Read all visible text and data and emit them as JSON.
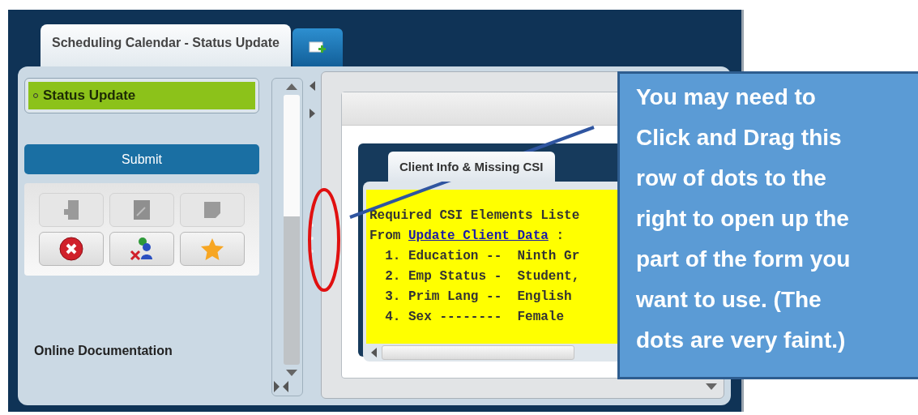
{
  "tabs": [
    {
      "label": "Scheduling Calendar - Status Update",
      "selected": true
    }
  ],
  "nav": [
    {
      "label": "Status Update",
      "selected": true
    }
  ],
  "submit_button": "Submit",
  "tool_buttons": [
    {
      "kind": "page",
      "disabled": true
    },
    {
      "kind": "edit",
      "disabled": true
    },
    {
      "kind": "note",
      "disabled": true
    },
    {
      "kind": "cancel",
      "disabled": false
    },
    {
      "kind": "remove-people",
      "disabled": false
    },
    {
      "kind": "star",
      "disabled": false
    }
  ],
  "documentation_link": "Online Documentation",
  "inner_panel": {
    "tabs": [
      {
        "label": "Client Info & Missing CSI",
        "selected": true
      }
    ],
    "lines": [
      {
        "text": "Required CSI Elements Liste"
      },
      {
        "text": "From ",
        "link": "Update Client Data",
        "rest": " :"
      },
      {
        "text": "  1. Education --  Ninth Gr"
      },
      {
        "text": "  2. Emp Status -  Student,"
      },
      {
        "text": "  3. Prim Lang --  English"
      },
      {
        "text": "  4. Sex --------  Female"
      }
    ]
  },
  "callout": {
    "lines": [
      "You may need to",
      "Click and Drag this",
      "row of dots to the",
      "right to open up the",
      "part of the form you",
      "want to use. (The",
      "dots are very faint.)"
    ]
  }
}
